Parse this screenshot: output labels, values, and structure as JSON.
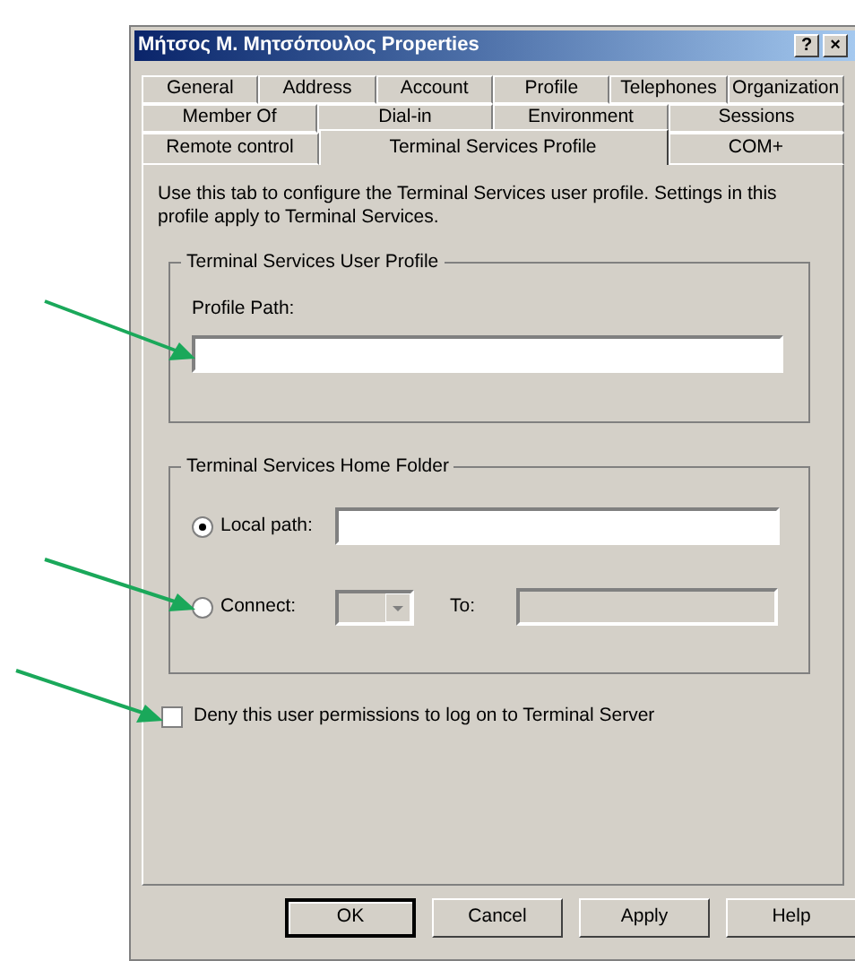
{
  "window": {
    "title": "Μήτσος Μ. Μητσόπουλος Properties",
    "title_buttons": [
      "?",
      "×"
    ]
  },
  "tab_rows": [
    [
      {
        "label": "General",
        "selected": false
      },
      {
        "label": "Address",
        "selected": false
      },
      {
        "label": "Account",
        "selected": false
      },
      {
        "label": "Profile",
        "selected": false
      },
      {
        "label": "Telephones",
        "selected": false
      },
      {
        "label": "Organization",
        "selected": false
      }
    ],
    [
      {
        "label": "Member Of",
        "selected": false
      },
      {
        "label": "Dial-in",
        "selected": false
      },
      {
        "label": "Environment",
        "selected": false
      },
      {
        "label": "Sessions",
        "selected": false
      }
    ],
    [
      {
        "label": "Remote control",
        "selected": false
      },
      {
        "label": "Terminal Services Profile",
        "selected": true
      },
      {
        "label": "COM+",
        "selected": false
      }
    ]
  ],
  "description": "Use this tab to configure the Terminal Services user profile. Settings in this profile apply to Terminal Services.",
  "user_profile": {
    "title": "Terminal Services User Profile",
    "profile_path_label": "Profile Path:"
  },
  "home_folder": {
    "title": "Terminal Services Home Folder",
    "options": [
      {
        "label": "Local path:",
        "selected": true
      },
      {
        "label": "Connect:",
        "selected": false
      }
    ],
    "to_label": "To:"
  },
  "deny_logon": {
    "label": "Deny this user permissions to log on to Terminal Server",
    "checked": false
  },
  "buttons": [
    {
      "label": "OK",
      "default": true
    },
    {
      "label": "Cancel",
      "default": false
    },
    {
      "label": "Apply",
      "default": false
    },
    {
      "label": "Help",
      "default": false
    }
  ]
}
